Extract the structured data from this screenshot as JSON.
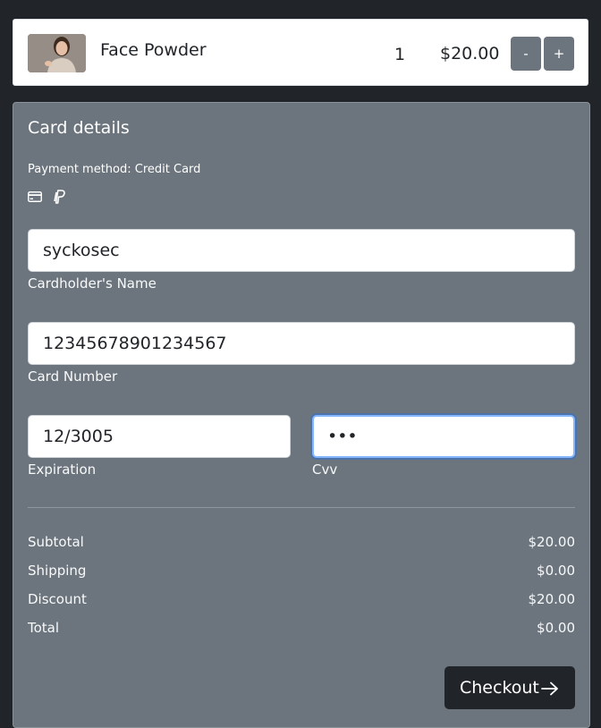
{
  "cart": {
    "item": {
      "name": "Face Powder",
      "image": "product-photo-woman",
      "quantity": "1",
      "price": "$20.00",
      "decrement_label": "-",
      "increment_label": "+"
    }
  },
  "card_details": {
    "title": "Card details",
    "payment_method": "Payment method: Credit Card",
    "payment_icons": [
      "credit-card-icon",
      "paypal-icon"
    ],
    "cardholder": {
      "value": "syckosec",
      "label": "Cardholder's Name"
    },
    "card_number": {
      "value": "12345678901234567",
      "label": "Card Number"
    },
    "expiration": {
      "value": "12/3005",
      "label": "Expiration"
    },
    "cvv": {
      "value": "•••",
      "label": "Cvv"
    }
  },
  "summary": {
    "subtotal": {
      "label": "Subtotal",
      "value": "$20.00"
    },
    "shipping": {
      "label": "Shipping",
      "value": "$0.00"
    },
    "discount": {
      "label": "Discount",
      "value": "$20.00"
    },
    "total": {
      "label": "Total",
      "value": "$0.00"
    }
  },
  "checkout": {
    "label": "Checkout",
    "icon": "arrow-right-icon"
  },
  "colors": {
    "page_bg": "#212529",
    "panel_bg": "#6c757d",
    "button_dark": "#212529",
    "button_secondary": "#6c757d",
    "focus_ring": "#86b7fe"
  }
}
